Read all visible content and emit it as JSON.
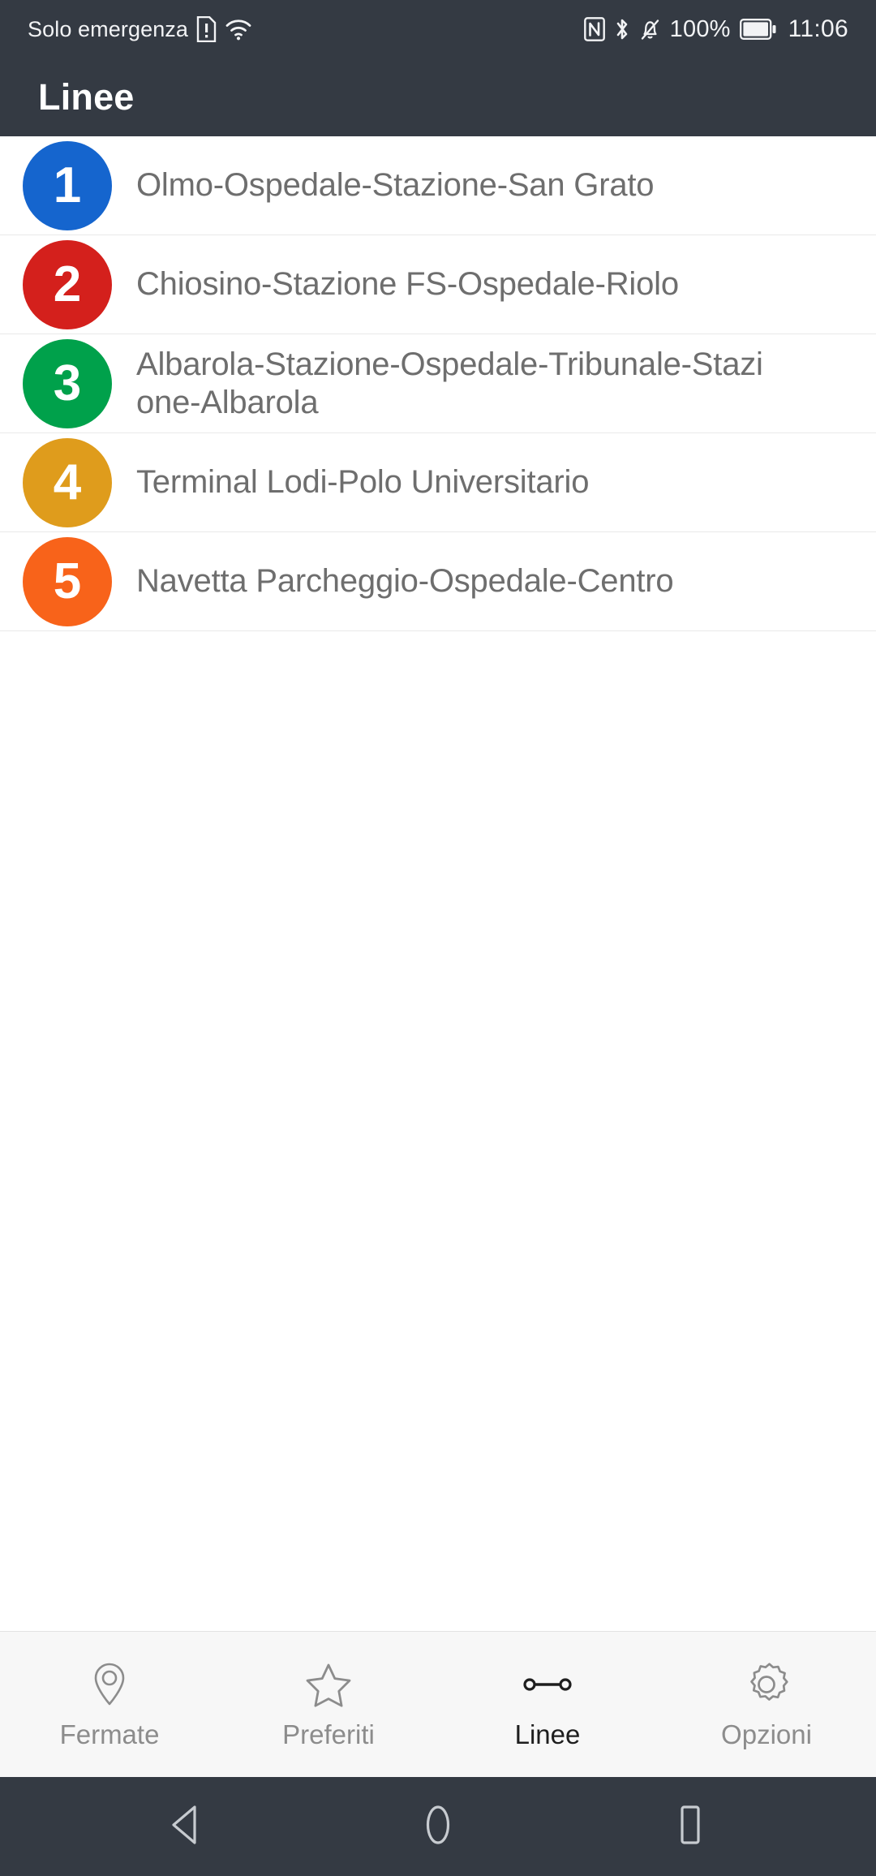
{
  "status_bar": {
    "carrier_text": "Solo emergenza",
    "sim_icon": "sim-alert-icon",
    "wifi_icon": "wifi-icon",
    "nfc_icon": "nfc-icon",
    "bluetooth_icon": "bluetooth-icon",
    "silent_icon": "bell-muted-icon",
    "battery_percent": "100%",
    "battery_icon": "battery-full-icon",
    "clock": "11:06"
  },
  "app_bar": {
    "title": "Linee"
  },
  "lines": [
    {
      "number": "1",
      "name": "Olmo-Ospedale-Stazione-San Grato",
      "color": "#1565CE"
    },
    {
      "number": "2",
      "name": "Chiosino-Stazione FS-Ospedale-Riolo",
      "color": "#D4201C"
    },
    {
      "number": "3",
      "name": "Albarola-Stazione-Ospedale-Tribunale-Stazione-Albarola",
      "color": "#00A14B"
    },
    {
      "number": "4",
      "name": "Terminal Lodi-Polo Universitario",
      "color": "#DF9C1C"
    },
    {
      "number": "5",
      "name": "Navetta Parcheggio-Ospedale-Centro",
      "color": "#F8631A"
    }
  ],
  "bottom_nav": {
    "items": [
      {
        "label": "Fermate",
        "icon": "map-pin-icon",
        "active": false
      },
      {
        "label": "Preferiti",
        "icon": "star-icon",
        "active": false
      },
      {
        "label": "Linee",
        "icon": "route-line-icon",
        "active": true
      },
      {
        "label": "Opzioni",
        "icon": "gear-icon",
        "active": false
      }
    ]
  },
  "android_nav": {
    "back": "back-triangle-icon",
    "home": "home-circle-icon",
    "recents": "recents-square-icon"
  },
  "colors": {
    "chrome": "#343a43",
    "list_text": "#6e6e6e",
    "nav_inactive": "#8c8c8c",
    "nav_active": "#1e1e1e"
  }
}
